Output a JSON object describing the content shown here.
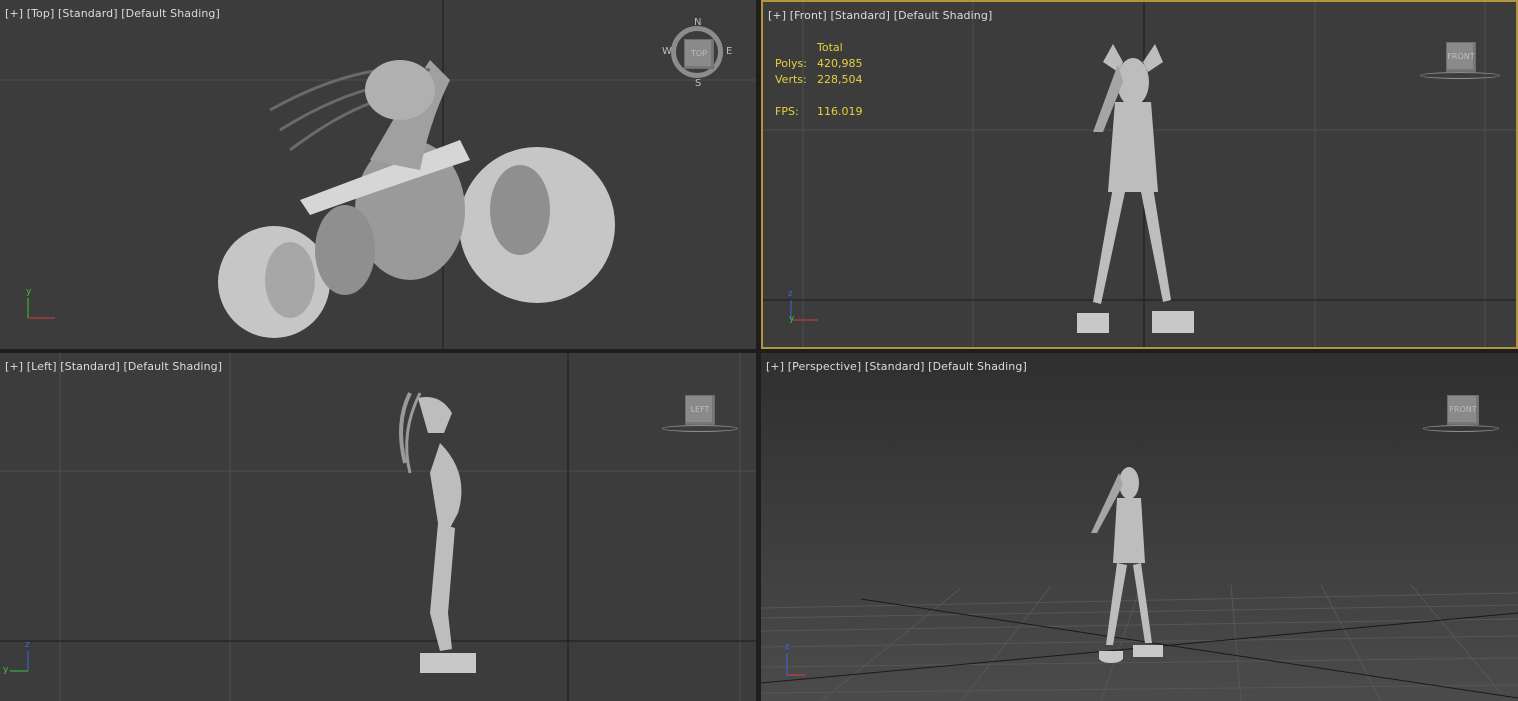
{
  "viewports": {
    "top": {
      "label_plus": "[+]",
      "label_view": "[Top]",
      "label_shading": "[Standard]",
      "label_mode": "[Default Shading]",
      "viewcube": {
        "face": "TOP",
        "n": "N",
        "s": "S",
        "e": "E",
        "w": "W"
      },
      "axis": {
        "v": "y",
        "h": "x"
      }
    },
    "front": {
      "label_plus": "[+]",
      "label_view": "[Front]",
      "label_shading": "[Standard]",
      "label_mode": "[Default Shading]",
      "viewcube": {
        "face": "FRONT"
      },
      "axis": {
        "v": "z",
        "h": "x"
      },
      "stats": {
        "header": "Total",
        "polys_label": "Polys:",
        "polys": "420,985",
        "verts_label": "Verts:",
        "verts": "228,504",
        "fps_label": "FPS:",
        "fps": "116.019"
      }
    },
    "left": {
      "label_plus": "[+]",
      "label_view": "[Left]",
      "label_shading": "[Standard]",
      "label_mode": "[Default Shading]",
      "viewcube": {
        "face": "LEFT"
      },
      "axis": {
        "v": "z",
        "h": "y"
      }
    },
    "perspective": {
      "label_plus": "[+]",
      "label_view": "[Perspective]",
      "label_shading": "[Standard]",
      "label_mode": "[Default Shading]",
      "viewcube": {
        "face": "FRONT"
      },
      "axis": {
        "v": "z",
        "h": "x"
      }
    }
  },
  "colors": {
    "active_border": "#b3963c",
    "stats_text": "#e6d23a",
    "model": "#bdbdbd",
    "grid": "#4e4e4e"
  }
}
